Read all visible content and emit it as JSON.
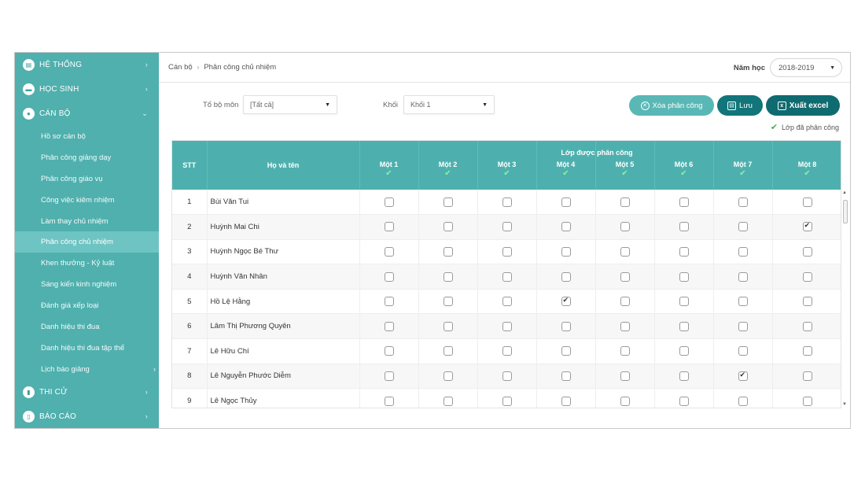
{
  "sidebar": {
    "sections": [
      {
        "label": "HỆ THỐNG",
        "icon": "system-icon"
      },
      {
        "label": "HỌC SINH",
        "icon": "student-icon"
      },
      {
        "label": "CÁN BỘ",
        "icon": "staff-icon"
      }
    ],
    "items": [
      {
        "label": "Hồ sơ cán bộ"
      },
      {
        "label": "Phân công giảng dạy"
      },
      {
        "label": "Phân công giáo vụ"
      },
      {
        "label": "Công việc kiêm nhiệm"
      },
      {
        "label": "Làm thay chủ nhiệm"
      },
      {
        "label": "Phân công chủ nhiệm",
        "active": true
      },
      {
        "label": "Khen thưởng - Kỷ luật"
      },
      {
        "label": "Sáng kiến kinh nghiệm"
      },
      {
        "label": "Đánh giá xếp loại"
      },
      {
        "label": "Danh hiệu thi đua"
      },
      {
        "label": "Danh hiệu thi đua tập thể"
      },
      {
        "label": "Lịch báo giảng"
      }
    ],
    "bottom_sections": [
      {
        "label": "THI CỬ",
        "icon": "exam-icon"
      },
      {
        "label": "BÁO CÁO",
        "icon": "report-icon"
      }
    ]
  },
  "breadcrumb": {
    "root": "Cán bộ",
    "current": "Phân công chủ nhiệm"
  },
  "year": {
    "label": "Năm học",
    "value": "2018-2019"
  },
  "filters": {
    "department_label": "Tổ bộ môn",
    "department_value": "[Tất cả]",
    "grade_label": "Khối",
    "grade_value": "Khối 1"
  },
  "buttons": {
    "clear": "Xóa phân công",
    "save": "Lưu",
    "export": "Xuất excel"
  },
  "legend": "Lớp đã phân công",
  "table": {
    "col_stt": "STT",
    "col_name": "Họ và tên",
    "group_title": "Lớp được phân công",
    "classes": [
      "Một 1",
      "Một 2",
      "Một 3",
      "Một 4",
      "Một 5",
      "Một 6",
      "Một 7",
      "Một 8"
    ],
    "rows": [
      {
        "stt": "1",
        "name": "Bùi Văn Tui",
        "checked": []
      },
      {
        "stt": "2",
        "name": "Huỳnh Mai Chi",
        "checked": [
          7
        ]
      },
      {
        "stt": "3",
        "name": "Huỳnh Ngọc Bé Thư",
        "checked": []
      },
      {
        "stt": "4",
        "name": "Huỳnh Văn Nhân",
        "checked": []
      },
      {
        "stt": "5",
        "name": "Hồ Lệ Hằng",
        "checked": [
          3
        ]
      },
      {
        "stt": "6",
        "name": "Lâm Thị Phương Quyên",
        "checked": []
      },
      {
        "stt": "7",
        "name": "Lê Hữu Chí",
        "checked": []
      },
      {
        "stt": "8",
        "name": "Lê Nguyễn Phước Diễm",
        "checked": [
          6
        ]
      },
      {
        "stt": "9",
        "name": "Lê Ngọc Thủy",
        "checked": []
      }
    ]
  }
}
